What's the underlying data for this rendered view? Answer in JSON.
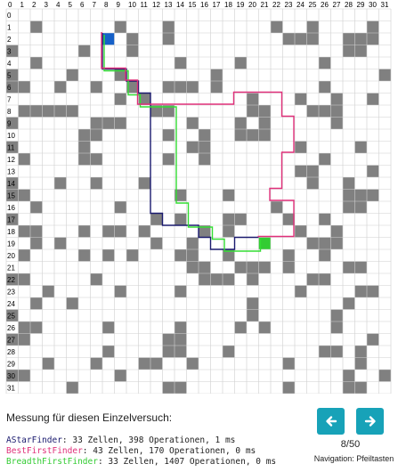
{
  "grid": {
    "cols": 32,
    "rows": 32,
    "col_labels": [
      "0",
      "1",
      "2",
      "3",
      "4",
      "5",
      "6",
      "7",
      "8",
      "9",
      "10",
      "11",
      "12",
      "13",
      "14",
      "15",
      "16",
      "17",
      "18",
      "19",
      "20",
      "21",
      "22",
      "23",
      "24",
      "25",
      "26",
      "27",
      "28",
      "29",
      "30",
      "31"
    ],
    "row_labels": [
      "0",
      "1",
      "2",
      "3",
      "4",
      "5",
      "6",
      "7",
      "8",
      "9",
      "10",
      "11",
      "12",
      "13",
      "14",
      "15",
      "16",
      "17",
      "18",
      "19",
      "20",
      "21",
      "22",
      "23",
      "24",
      "25",
      "26",
      "27",
      "28",
      "29",
      "30",
      "31"
    ],
    "wall_color": "#808080",
    "start": {
      "col": 8,
      "row": 2,
      "color": "#1560c8"
    },
    "goal": {
      "col": 21,
      "row": 19,
      "color": "#33cc33"
    },
    "walls": [
      [
        2,
        1
      ],
      [
        9,
        1
      ],
      [
        13,
        1
      ],
      [
        22,
        1
      ],
      [
        25,
        1
      ],
      [
        30,
        1
      ],
      [
        10,
        2
      ],
      [
        13,
        2
      ],
      [
        23,
        2
      ],
      [
        24,
        2
      ],
      [
        25,
        2
      ],
      [
        28,
        2
      ],
      [
        29,
        2
      ],
      [
        30,
        2
      ],
      [
        0,
        3
      ],
      [
        6,
        3
      ],
      [
        10,
        3
      ],
      [
        28,
        3
      ],
      [
        29,
        3
      ],
      [
        2,
        4
      ],
      [
        14,
        4
      ],
      [
        19,
        4
      ],
      [
        26,
        4
      ],
      [
        0,
        5
      ],
      [
        5,
        5
      ],
      [
        9,
        5
      ],
      [
        17,
        5
      ],
      [
        31,
        5
      ],
      [
        0,
        6
      ],
      [
        1,
        6
      ],
      [
        4,
        6
      ],
      [
        7,
        6
      ],
      [
        10,
        6
      ],
      [
        13,
        6
      ],
      [
        14,
        6
      ],
      [
        15,
        6
      ],
      [
        17,
        6
      ],
      [
        26,
        6
      ],
      [
        9,
        7
      ],
      [
        11,
        7
      ],
      [
        20,
        7
      ],
      [
        24,
        7
      ],
      [
        27,
        7
      ],
      [
        30,
        7
      ],
      [
        1,
        8
      ],
      [
        2,
        8
      ],
      [
        3,
        8
      ],
      [
        4,
        8
      ],
      [
        5,
        8
      ],
      [
        12,
        8
      ],
      [
        13,
        8
      ],
      [
        20,
        8
      ],
      [
        21,
        8
      ],
      [
        25,
        8
      ],
      [
        26,
        8
      ],
      [
        27,
        8
      ],
      [
        0,
        9
      ],
      [
        7,
        9
      ],
      [
        8,
        9
      ],
      [
        9,
        9
      ],
      [
        15,
        9
      ],
      [
        19,
        9
      ],
      [
        21,
        9
      ],
      [
        27,
        9
      ],
      [
        6,
        10
      ],
      [
        7,
        10
      ],
      [
        13,
        10
      ],
      [
        16,
        10
      ],
      [
        19,
        10
      ],
      [
        20,
        10
      ],
      [
        21,
        10
      ],
      [
        0,
        11
      ],
      [
        6,
        11
      ],
      [
        15,
        11
      ],
      [
        16,
        11
      ],
      [
        24,
        11
      ],
      [
        29,
        11
      ],
      [
        1,
        12
      ],
      [
        6,
        12
      ],
      [
        7,
        12
      ],
      [
        13,
        12
      ],
      [
        16,
        12
      ],
      [
        26,
        12
      ],
      [
        24,
        13
      ],
      [
        25,
        13
      ],
      [
        30,
        13
      ],
      [
        0,
        14
      ],
      [
        4,
        14
      ],
      [
        7,
        14
      ],
      [
        11,
        14
      ],
      [
        25,
        14
      ],
      [
        28,
        14
      ],
      [
        0,
        15
      ],
      [
        1,
        15
      ],
      [
        14,
        15
      ],
      [
        18,
        15
      ],
      [
        28,
        15
      ],
      [
        29,
        15
      ],
      [
        30,
        15
      ],
      [
        2,
        16
      ],
      [
        9,
        16
      ],
      [
        22,
        16
      ],
      [
        28,
        16
      ],
      [
        29,
        16
      ],
      [
        0,
        17
      ],
      [
        12,
        17
      ],
      [
        14,
        17
      ],
      [
        18,
        17
      ],
      [
        19,
        17
      ],
      [
        23,
        17
      ],
      [
        26,
        17
      ],
      [
        1,
        18
      ],
      [
        2,
        18
      ],
      [
        6,
        18
      ],
      [
        8,
        18
      ],
      [
        9,
        18
      ],
      [
        11,
        18
      ],
      [
        16,
        18
      ],
      [
        18,
        18
      ],
      [
        24,
        18
      ],
      [
        27,
        18
      ],
      [
        2,
        19
      ],
      [
        4,
        19
      ],
      [
        12,
        19
      ],
      [
        15,
        19
      ],
      [
        25,
        19
      ],
      [
        26,
        19
      ],
      [
        27,
        19
      ],
      [
        1,
        20
      ],
      [
        6,
        20
      ],
      [
        8,
        20
      ],
      [
        10,
        20
      ],
      [
        14,
        20
      ],
      [
        15,
        20
      ],
      [
        18,
        20
      ],
      [
        23,
        20
      ],
      [
        26,
        20
      ],
      [
        15,
        21
      ],
      [
        16,
        21
      ],
      [
        19,
        21
      ],
      [
        20,
        21
      ],
      [
        21,
        21
      ],
      [
        23,
        21
      ],
      [
        28,
        21
      ],
      [
        29,
        21
      ],
      [
        0,
        22
      ],
      [
        1,
        22
      ],
      [
        7,
        22
      ],
      [
        16,
        22
      ],
      [
        17,
        22
      ],
      [
        18,
        22
      ],
      [
        20,
        22
      ],
      [
        25,
        22
      ],
      [
        26,
        22
      ],
      [
        3,
        23
      ],
      [
        9,
        23
      ],
      [
        14,
        23
      ],
      [
        24,
        23
      ],
      [
        29,
        23
      ],
      [
        30,
        23
      ],
      [
        2,
        24
      ],
      [
        5,
        24
      ],
      [
        20,
        24
      ],
      [
        28,
        24
      ],
      [
        0,
        25
      ],
      [
        20,
        25
      ],
      [
        27,
        25
      ],
      [
        1,
        26
      ],
      [
        2,
        26
      ],
      [
        8,
        26
      ],
      [
        14,
        26
      ],
      [
        19,
        26
      ],
      [
        21,
        26
      ],
      [
        27,
        26
      ],
      [
        0,
        27
      ],
      [
        1,
        27
      ],
      [
        13,
        27
      ],
      [
        14,
        27
      ],
      [
        30,
        27
      ],
      [
        8,
        28
      ],
      [
        13,
        28
      ],
      [
        14,
        28
      ],
      [
        18,
        28
      ],
      [
        26,
        28
      ],
      [
        27,
        28
      ],
      [
        29,
        28
      ],
      [
        3,
        29
      ],
      [
        7,
        29
      ],
      [
        11,
        29
      ],
      [
        12,
        29
      ],
      [
        15,
        29
      ],
      [
        23,
        29
      ],
      [
        29,
        29
      ],
      [
        0,
        30
      ],
      [
        1,
        30
      ],
      [
        9,
        30
      ],
      [
        28,
        30
      ],
      [
        31,
        30
      ],
      [
        5,
        31
      ],
      [
        13,
        31
      ],
      [
        14,
        31
      ],
      [
        23,
        31
      ],
      [
        28,
        31
      ],
      [
        29,
        31
      ]
    ],
    "paths": [
      {
        "color": "#1a1a6e",
        "points": [
          [
            8,
            2
          ],
          [
            8,
            5
          ],
          [
            10,
            5
          ],
          [
            10,
            6
          ],
          [
            11,
            6
          ],
          [
            11,
            7
          ],
          [
            12,
            7
          ],
          [
            12,
            17
          ],
          [
            13,
            17
          ],
          [
            13,
            18
          ],
          [
            16,
            18
          ],
          [
            16,
            19
          ],
          [
            17,
            19
          ],
          [
            17,
            20
          ],
          [
            19,
            20
          ],
          [
            19,
            19
          ],
          [
            21,
            19
          ]
        ]
      },
      {
        "color": "#33dd33",
        "points": [
          [
            8,
            2
          ],
          [
            8,
            5
          ],
          [
            10,
            5
          ],
          [
            10,
            7
          ],
          [
            11,
            7
          ],
          [
            11,
            8
          ],
          [
            14,
            8
          ],
          [
            14,
            16
          ],
          [
            15,
            16
          ],
          [
            15,
            18
          ],
          [
            17,
            18
          ],
          [
            17,
            19
          ],
          [
            18,
            19
          ],
          [
            18,
            20
          ],
          [
            21,
            20
          ],
          [
            21,
            19
          ]
        ]
      },
      {
        "color": "#e0307a",
        "points": [
          [
            8,
            2
          ],
          [
            8,
            5
          ],
          [
            10,
            5
          ],
          [
            10,
            6
          ],
          [
            11,
            6
          ],
          [
            11,
            7
          ],
          [
            11,
            8
          ],
          [
            19,
            8
          ],
          [
            19,
            7
          ],
          [
            23,
            7
          ],
          [
            23,
            9
          ],
          [
            24,
            9
          ],
          [
            24,
            12
          ],
          [
            23,
            12
          ],
          [
            23,
            15
          ],
          [
            22,
            15
          ],
          [
            22,
            16
          ],
          [
            24,
            16
          ],
          [
            24,
            19
          ],
          [
            21,
            19
          ]
        ]
      }
    ]
  },
  "measurement": {
    "title": "Messung für diesen Einzelversuch:",
    "results": [
      {
        "name": "AStarFinder",
        "color": "#1a1a6e",
        "text": ": 33 Zellen, 398 Operationen, 1 ms"
      },
      {
        "name": "BestFirstFinder",
        "color": "#e0307a",
        "text": ": 43 Zellen, 170 Operationen, 0 ms"
      },
      {
        "name": "BreadthFirstFinder",
        "color": "#33cc33",
        "text": ": 33 Zellen, 1407 Operationen, 0 ms"
      }
    ]
  },
  "navigation": {
    "prev_icon": "arrow-left-icon",
    "next_icon": "arrow-right-icon",
    "accent": "#17a2b8",
    "counter": "8/50",
    "hint": "Navigation: Pfeiltasten"
  }
}
